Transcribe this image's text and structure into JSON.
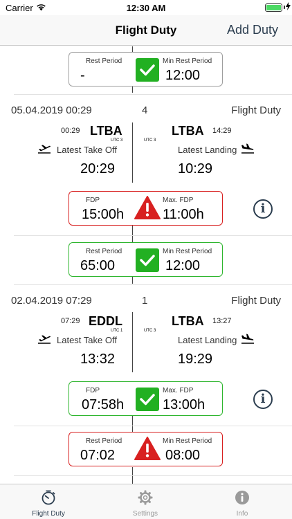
{
  "status_bar": {
    "carrier": "Carrier",
    "time": "12:30 AM"
  },
  "nav": {
    "title": "Flight Duty",
    "action": "Add Duty"
  },
  "colors": {
    "accent": "#2c3e50",
    "ok_green": "#22b022",
    "warn_red": "#d82020",
    "battery": "#4cd964"
  },
  "rest_top": {
    "left_label": "Rest Period",
    "left_value": "-",
    "right_label": "Min Rest Period",
    "right_value": "12:00",
    "status": "ok"
  },
  "duties": [
    {
      "date": "05.04.2019 00:29",
      "count": "4",
      "type": "Flight Duty",
      "dep": {
        "time": "00:29",
        "station": "LTBA",
        "utc": "UTC 3",
        "label": "Latest Take Off",
        "big_time": "20:29"
      },
      "arr": {
        "time": "14:29",
        "station": "LTBA",
        "utc": "UTC 3",
        "label": "Latest Landing",
        "big_time": "10:29"
      },
      "fdp": {
        "left_label": "FDP",
        "left_value": "15:00h",
        "right_label": "Max. FDP",
        "right_value": "11:00h",
        "status": "warning"
      },
      "rest": {
        "left_label": "Rest Period",
        "left_value": "65:00",
        "right_label": "Min Rest Period",
        "right_value": "12:00",
        "status": "ok"
      }
    },
    {
      "date": "02.04.2019 07:29",
      "count": "1",
      "type": "Flight Duty",
      "dep": {
        "time": "07:29",
        "station": "EDDL",
        "utc": "UTC 1",
        "label": "Latest Take Off",
        "big_time": "13:32"
      },
      "arr": {
        "time": "13:27",
        "station": "LTBA",
        "utc": "UTC 3",
        "label": "Latest Landing",
        "big_time": "19:29"
      },
      "fdp": {
        "left_label": "FDP",
        "left_value": "07:58h",
        "right_label": "Max. FDP",
        "right_value": "13:00h",
        "status": "ok"
      },
      "rest": {
        "left_label": "Rest Period",
        "left_value": "07:02",
        "right_label": "Min Rest Period",
        "right_value": "08:00",
        "status": "warning"
      }
    }
  ],
  "info_glyph": "i",
  "tabs": [
    {
      "label": "Flight Duty",
      "icon": "stopwatch-icon",
      "active": true
    },
    {
      "label": "Settings",
      "icon": "gear-icon",
      "active": false
    },
    {
      "label": "Info",
      "icon": "info-icon",
      "active": false
    }
  ]
}
